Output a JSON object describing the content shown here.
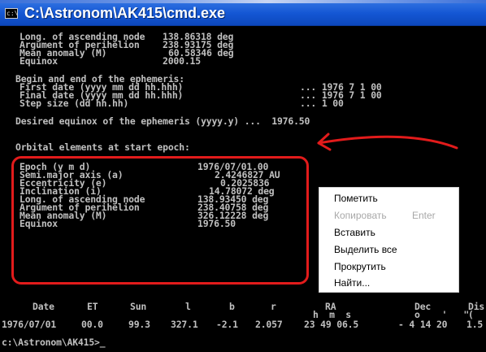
{
  "window": {
    "title": "C:\\Astronom\\AK415\\cmd.exe",
    "icon_glyph": "c:\\"
  },
  "console": {
    "prev_elements": [
      {
        "label": "Long. of ascending node",
        "value": "138.86318 deg"
      },
      {
        "label": "Argument of perihelion",
        "value": "238.93175 deg"
      },
      {
        "label": "Mean anomaly (M)",
        "value": "60.58346 deg"
      },
      {
        "label": "Equinox",
        "value": "2000.15"
      }
    ],
    "ephemeris_header": "Begin and end of the ephemeris:",
    "ephemeris_rows": [
      {
        "label": "First date (yyyy mm dd hh.hhh)",
        "value": "... 1976 7 1 00"
      },
      {
        "label": "Final date (yyyy mm dd hh.hhh)",
        "value": "... 1976 7 1 00"
      },
      {
        "label": "Step size (dd hh.hh)",
        "value": "... 1 00"
      }
    ],
    "equinox_prompt": "Desired equinox of the ephemeris (yyyy.y) ...  1976.50",
    "orbital_header": "Orbital elements at start epoch:",
    "orbital_rows": [
      {
        "label": "Epoch (y m d)",
        "value": "1976/07/01.00"
      },
      {
        "label": "Semi.major axis (a)",
        "value": "2.4246827 AU"
      },
      {
        "label": "Eccentricity (e)",
        "value": "0.2025836"
      },
      {
        "label": "Inclination (i)",
        "value": "14.78072 deg"
      },
      {
        "label": "Long. of ascending node",
        "value": "138.93450 deg"
      },
      {
        "label": "Argument of perihelion",
        "value": "238.40758 deg"
      },
      {
        "label": "Mean anomaly (M)",
        "value": "326.12228 deg"
      },
      {
        "label": "Equinox",
        "value": "1976.50"
      }
    ],
    "table": {
      "headers": [
        "Date",
        "ET",
        "Sun",
        "l",
        "b",
        "r",
        "RA",
        "Dec",
        "Dis"
      ],
      "subheader_ra": "h  m  s",
      "subheader_dec": "o    '   \"",
      "subheader_dis": "(",
      "row": [
        "1976/07/01",
        "00.0",
        "99.3",
        "327.1",
        "-2.1",
        "2.057",
        "23 49 06.5",
        "- 4 14 20",
        "1.5"
      ]
    },
    "prompt": "c:\\Astronom\\AK415>_"
  },
  "context_menu": {
    "items": [
      {
        "label": "Пометить",
        "enabled": true
      },
      {
        "label": "Копировать",
        "enabled": false,
        "shortcut": "Enter"
      },
      {
        "label": "Вставить",
        "enabled": true
      },
      {
        "label": "Выделить все",
        "enabled": true
      },
      {
        "label": "Прокрутить",
        "enabled": true
      },
      {
        "label": "Найти...",
        "enabled": true
      }
    ]
  },
  "colors": {
    "titlebar": "#1457d4",
    "console_bg": "#000000",
    "console_text": "#c0c0c0",
    "annotation": "#e21b1b"
  }
}
